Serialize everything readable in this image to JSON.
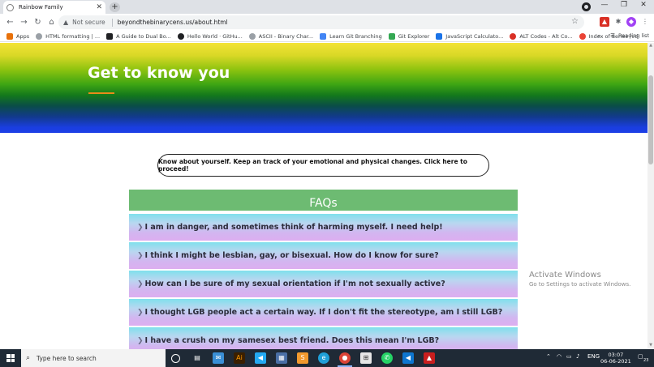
{
  "browser": {
    "tab_title": "Rainbow Family",
    "new_tab_symbol": "+",
    "omnibox": {
      "security_label": "Not secure",
      "url": "beyondthebinarycens.us/about.html"
    },
    "bookmarks": [
      {
        "label": "Apps",
        "color": "#e8710a"
      },
      {
        "label": "HTML formatting | ...",
        "color": "#9aa0a6"
      },
      {
        "label": "A Guide to Dual Bo...",
        "color": "#202124"
      },
      {
        "label": "Hello World · GitHu...",
        "color": "#202124"
      },
      {
        "label": "ASCII - Binary Char...",
        "color": "#9aa0a6"
      },
      {
        "label": "Learn Git Branching",
        "color": "#4285f4"
      },
      {
        "label": "Git Explorer",
        "color": "#34a853"
      },
      {
        "label": "JavaScript Calculato...",
        "color": "#1a73e8"
      },
      {
        "label": "ALT Codes - Alt Co...",
        "color": "#d93025"
      },
      {
        "label": "Index of Series /vd",
        "color": "#ea4335"
      }
    ],
    "more_bookmarks": "»",
    "reading_list": "Reading list"
  },
  "page": {
    "hero_title": "Get to know you",
    "cta_text": "Know about yourself. Keep an track of your emotional and physical changes. Click here to proceed!",
    "faq_heading": "FAQs",
    "faqs": [
      "I am in danger, and sometimes think of harming myself. I need help!",
      "I think I might be lesbian, gay, or bisexual. How do I know for sure?",
      "How can I be sure of my sexual orientation if I'm not sexually active?",
      " I thought LGB people act a certain way. If I don't fit the stereotype, am I still LGB?",
      "I have a crush on my samesex best friend. Does this mean I'm LGB?"
    ]
  },
  "watermark": {
    "line1": "Activate Windows",
    "line2": "Go to Settings to activate Windows."
  },
  "taskbar": {
    "search_placeholder": "Type here to search",
    "language": "ENG",
    "time": "03:07",
    "date": "06-06-2021",
    "notification_count": "23"
  },
  "colors": {
    "faq_header": "#6dbb72",
    "hero_underline": "#e88a1a"
  }
}
